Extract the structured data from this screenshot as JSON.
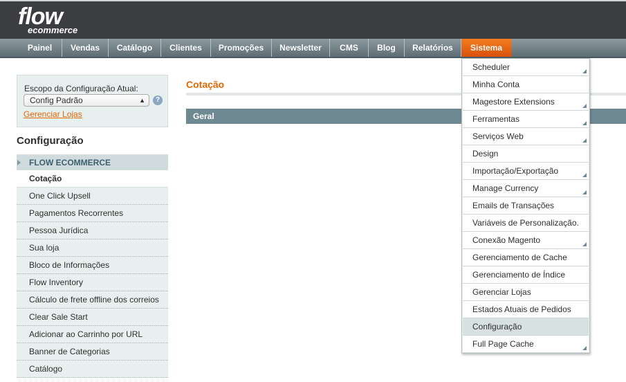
{
  "logo": {
    "line1": "flow",
    "line2": "ecommerce"
  },
  "nav": [
    {
      "label": "Painel"
    },
    {
      "label": "Vendas"
    },
    {
      "label": "Catálogo"
    },
    {
      "label": "Clientes"
    },
    {
      "label": "Promoções"
    },
    {
      "label": "Newsletter"
    },
    {
      "label": "CMS"
    },
    {
      "label": "Blog"
    },
    {
      "label": "Relatórios"
    },
    {
      "label": "Sistema",
      "active": true
    }
  ],
  "scope": {
    "label": "Escopo da Configuração Atual:",
    "selected": "Config Padrão",
    "link": "Gerenciar Lojas",
    "help_icon": "question-icon"
  },
  "sidebar": {
    "title": "Configuração",
    "section": "FLOW ECOMMERCE",
    "items": [
      {
        "label": "Cotação",
        "active": true
      },
      {
        "label": "One Click Upsell"
      },
      {
        "label": "Pagamentos Recorrentes"
      },
      {
        "label": "Pessoa Jurídica"
      },
      {
        "label": "Sua loja"
      },
      {
        "label": "Bloco de Informações"
      },
      {
        "label": "Flow Inventory"
      },
      {
        "label": "Cálculo de frete offline dos correios"
      },
      {
        "label": "Clear Sale Start"
      },
      {
        "label": "Adicionar ao Carrinho por URL"
      },
      {
        "label": "Banner de Categorias"
      },
      {
        "label": "Catálogo"
      }
    ]
  },
  "main": {
    "title": "Cotação",
    "group": "Geral"
  },
  "menu": {
    "items": [
      {
        "label": "Scheduler",
        "submenu": true
      },
      {
        "label": "Minha Conta"
      },
      {
        "label": "Magestore Extensions",
        "submenu": true
      },
      {
        "label": "Ferramentas",
        "submenu": true
      },
      {
        "label": "Serviços Web",
        "submenu": true
      },
      {
        "label": "Design"
      },
      {
        "label": "Importação/Exportação",
        "submenu": true
      },
      {
        "label": "Manage Currency",
        "submenu": true
      },
      {
        "label": "Emails de Transações"
      },
      {
        "label": "Variáveis de Personalização."
      },
      {
        "label": "Conexão Magento",
        "submenu": true
      },
      {
        "label": "Gerenciamento de Cache"
      },
      {
        "label": "Gerenciamento de Índice"
      },
      {
        "label": "Gerenciar Lojas"
      },
      {
        "label": "Estados Atuais de Pedidos"
      },
      {
        "label": "Configuração",
        "active": true
      },
      {
        "label": "Full Page Cache",
        "submenu": true
      }
    ]
  },
  "colors": {
    "accent": "#e26703",
    "nav_active": "#eb6a14",
    "header": "#3b3d40",
    "group_bar": "#6f8992"
  }
}
